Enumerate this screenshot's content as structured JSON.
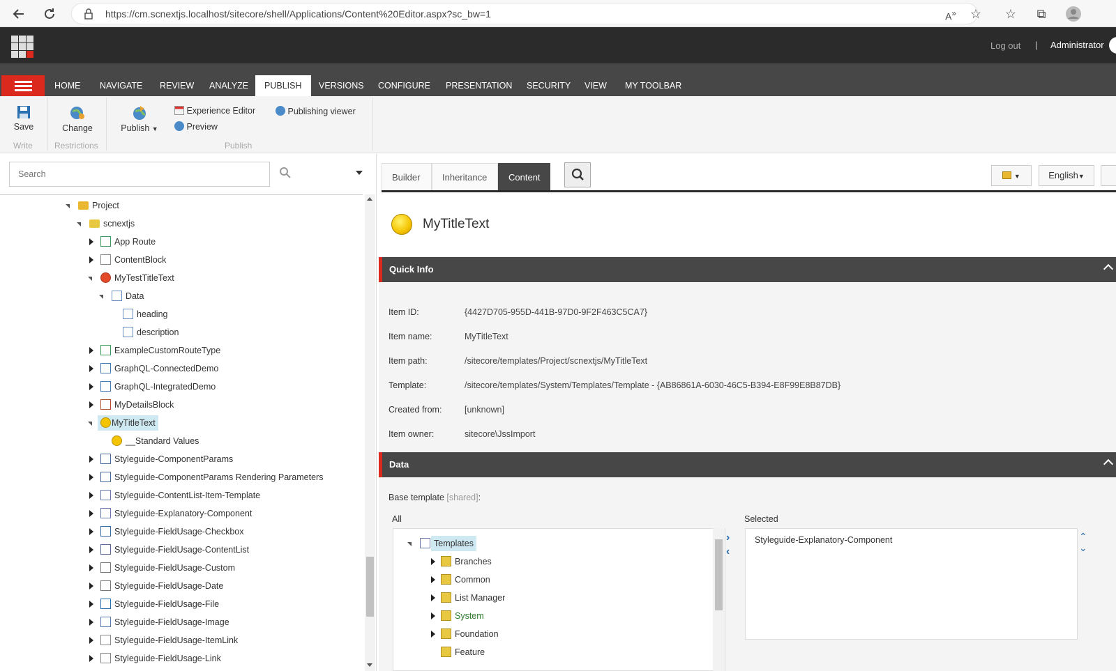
{
  "browser": {
    "url": "https://cm.scnextjs.localhost/sitecore/shell/Applications/Content%20Editor.aspx?sc_bw=1",
    "icons": [
      "back-icon",
      "refresh-icon",
      "lock-icon",
      "read-aloud-icon",
      "favorite-add-icon",
      "favorites-icon",
      "collections-icon",
      "profile-icon"
    ]
  },
  "header": {
    "logout": "Log out",
    "separator": "|",
    "user": "Administrator"
  },
  "ribbon_tabs": [
    "HOME",
    "NAVIGATE",
    "REVIEW",
    "ANALYZE",
    "PUBLISH",
    "VERSIONS",
    "CONFIGURE",
    "PRESENTATION",
    "SECURITY",
    "VIEW",
    "MY TOOLBAR"
  ],
  "active_tab": "PUBLISH",
  "ribbon": {
    "save": "Save",
    "write": "Write",
    "change": "Change",
    "restrictions": "Restrictions",
    "publish": "Publish",
    "experience_editor": "Experience Editor",
    "preview": "Preview",
    "publishing_viewer": "Publishing viewer",
    "publish_group": "Publish"
  },
  "search": {
    "placeholder": "Search"
  },
  "tree": [
    {
      "label": "Project",
      "state": "e",
      "icon": "folder-template-icon",
      "level": 0
    },
    {
      "label": "scnextjs",
      "state": "e",
      "icon": "folder-icon",
      "level": 1
    },
    {
      "label": "App Route",
      "state": "c",
      "icon": "route-icon",
      "level": 2
    },
    {
      "label": "ContentBlock",
      "state": "c",
      "icon": "content-block-icon",
      "level": 2
    },
    {
      "label": "MyTestTitleText",
      "state": "e",
      "icon": "red-dot-icon",
      "level": 2
    },
    {
      "label": "Data",
      "state": "e",
      "icon": "document-icon",
      "level": 3
    },
    {
      "label": "heading",
      "state": "",
      "icon": "document-icon",
      "level": 4
    },
    {
      "label": "description",
      "state": "",
      "icon": "document-icon",
      "level": 4
    },
    {
      "label": "ExampleCustomRouteType",
      "state": "c",
      "icon": "route-icon",
      "level": 2
    },
    {
      "label": "GraphQL-ConnectedDemo",
      "state": "c",
      "icon": "link-chain-icon",
      "level": 2
    },
    {
      "label": "GraphQL-IntegratedDemo",
      "state": "c",
      "icon": "link-chain-icon",
      "level": 2
    },
    {
      "label": "MyDetailsBlock",
      "state": "c",
      "icon": "volcano-icon",
      "level": 2
    },
    {
      "label": "MyTitleText",
      "state": "e",
      "icon": "yellow-dot-icon",
      "level": 2,
      "selected": true
    },
    {
      "label": "__Standard Values",
      "state": "",
      "icon": "yellow-dot-icon",
      "level": 3
    },
    {
      "label": "Styleguide-ComponentParams",
      "state": "c",
      "icon": "table-icon",
      "level": 2
    },
    {
      "label": "Styleguide-ComponentParams Rendering Parameters",
      "state": "c",
      "icon": "table-icon",
      "level": 2
    },
    {
      "label": "Styleguide-ContentList-Item-Template",
      "state": "c",
      "icon": "template-icon",
      "level": 2
    },
    {
      "label": "Styleguide-Explanatory-Component",
      "state": "c",
      "icon": "template-icon",
      "level": 2
    },
    {
      "label": "Styleguide-FieldUsage-Checkbox",
      "state": "c",
      "icon": "checkbox-icon",
      "level": 2
    },
    {
      "label": "Styleguide-FieldUsage-ContentList",
      "state": "c",
      "icon": "list-icon",
      "level": 2
    },
    {
      "label": "Styleguide-FieldUsage-Custom",
      "state": "c",
      "icon": "gear-icon",
      "level": 2
    },
    {
      "label": "Styleguide-FieldUsage-Date",
      "state": "c",
      "icon": "clock-icon",
      "level": 2
    },
    {
      "label": "Styleguide-FieldUsage-File",
      "state": "c",
      "icon": "floppy-icon",
      "level": 2
    },
    {
      "label": "Styleguide-FieldUsage-Image",
      "state": "c",
      "icon": "image-icon",
      "level": 2
    },
    {
      "label": "Styleguide-FieldUsage-ItemLink",
      "state": "c",
      "icon": "link-icon",
      "level": 2
    },
    {
      "label": "Styleguide-FieldUsage-Link",
      "state": "c",
      "icon": "link-icon",
      "level": 2
    }
  ],
  "content_tabs": [
    "Builder",
    "Inheritance",
    "Content"
  ],
  "active_content_tab": "Content",
  "language": "English",
  "item": {
    "title": "MyTitleText"
  },
  "quick_info": {
    "header": "Quick Info",
    "rows": [
      {
        "label": "Item ID:",
        "value": "{4427D705-955D-441B-97D0-9F2F463C5CA7}"
      },
      {
        "label": "Item name:",
        "value": "MyTitleText"
      },
      {
        "label": "Item path:",
        "value": "/sitecore/templates/Project/scnextjs/MyTitleText"
      },
      {
        "label": "Template:",
        "value": "/sitecore/templates/System/Templates/Template - {AB86861A-6030-46C5-B394-E8F99E8B87DB}"
      },
      {
        "label": "Created from:",
        "value": "[unknown]"
      },
      {
        "label": "Item owner:",
        "value": "sitecore\\JssImport"
      }
    ]
  },
  "data_section": {
    "header": "Data",
    "base_template": "Base template",
    "shared": "[shared]",
    "colon": ":",
    "all": "All",
    "selected": "Selected",
    "all_tree": [
      {
        "label": "Templates",
        "state": "e",
        "level": 0,
        "selected": true
      },
      {
        "label": "Branches",
        "state": "c",
        "level": 1
      },
      {
        "label": "Common",
        "state": "c",
        "level": 1
      },
      {
        "label": "List Manager",
        "state": "c",
        "level": 1
      },
      {
        "label": "System",
        "state": "c",
        "level": 1,
        "green": true
      },
      {
        "label": "Foundation",
        "state": "c",
        "level": 1
      },
      {
        "label": "Feature",
        "state": "",
        "level": 1
      }
    ],
    "selected_items": [
      "Styleguide-Explanatory-Component"
    ]
  },
  "colors": {
    "accent_red": "#dc291e",
    "dark_bar": "#2b2b2b",
    "tab_bar": "#474747",
    "selection": "#cfe9f2"
  }
}
